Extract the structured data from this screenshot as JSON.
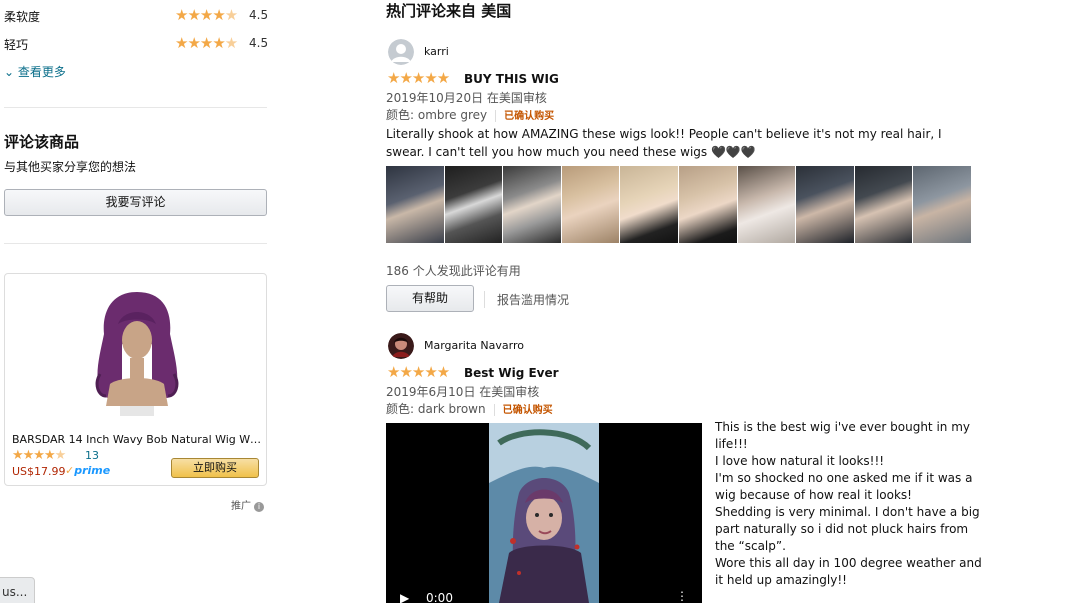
{
  "attributes": [
    {
      "label": "柔软度",
      "rating": "4.5"
    },
    {
      "label": "轻巧",
      "rating": "4.5"
    }
  ],
  "see_more": "查看更多",
  "write_review": {
    "heading": "评论该商品",
    "subtext": "与其他买家分享您的想法",
    "button": "我要写评论"
  },
  "ad": {
    "title": "BARSDAR 14 Inch Wavy Bob Natural Wig Wit…",
    "rating_count": "13",
    "price": "US$17.99",
    "prime": "prime",
    "buy_button": "立即购买",
    "sponsored": "推广"
  },
  "bottom_tab": "us...",
  "main": {
    "heading": "热门评论来自 美国",
    "reviews": [
      {
        "reviewer": "karri",
        "title": "BUY THIS WIG",
        "date": "2019年10月20日 在美国审核",
        "variant": "颜色: ombre grey",
        "verified": "已确认购买",
        "body": "Literally shook at how AMAZING these wigs look!! People can't believe it's not my real hair, I swear. I can't tell you how much you need these wigs 🖤🖤🖤",
        "helpful_count": "186 个人发现此评论有用",
        "helpful_button": "有帮助",
        "report": "报告滥用情况"
      },
      {
        "reviewer": "Margarita Navarro",
        "title": "Best Wig Ever",
        "date": "2019年6月10日 在美国审核",
        "variant": "颜色: dark brown",
        "verified": "已确认购买",
        "body": " This is the best wig i've ever bought in my life!!!\nI love how natural it looks!!!\nI'm so shocked no one asked me if it was a wig because of how real it looks!\nShedding is very minimal. I don't have a big part naturally so i did not pluck hairs from the “scalp”.\nWore this all day in 100 degree weather and it held up amazingly!!",
        "video_time": "0:00"
      }
    ]
  },
  "colors": {
    "star": "#f3a847",
    "link": "#0a6e8a",
    "verified": "#c45500",
    "price": "#b12704"
  }
}
